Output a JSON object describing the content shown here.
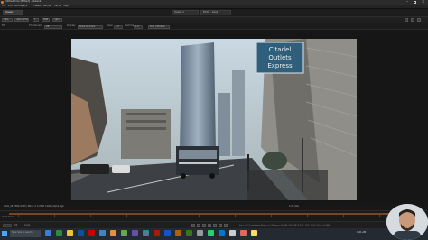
{
  "app": {
    "window_title": "Untitled.hrox [Edited] - Nuke12"
  },
  "menu": [
    "File",
    "Edit",
    "Workspace",
    "Viewer",
    "Render",
    "Cache",
    "Help"
  ],
  "tabs": [
    {
      "label": "Viewer"
    },
    {
      "label": "Viewer 1"
    },
    {
      "label": "Editor - Seq1"
    }
  ],
  "toolbar1": {
    "channels_value": "rgba",
    "alpha_value": "rgba.alpha",
    "a_input": "1",
    "mode_value": "RGB",
    "b_input": "rgba"
  },
  "toolbar2": {
    "fit_label": "Fit",
    "thumbnails_label": "Thumbnails",
    "thumbnails_value": "Off",
    "display_label": "Display",
    "display_value": "Show top track",
    "gain_label": "Gain",
    "gain_value": "1.0",
    "gamma_label": "Gamma",
    "gamma_value": "1.0",
    "view_value": "Sum | Window"
  },
  "frame_signs": {
    "sign_line1": "Citadel",
    "sign_line2": "Outlets",
    "sign_line3": "Express"
  },
  "status": {
    "left_text": "LA02_4K 2560x1440 | Bbox: 0 0 2560 1440 | Alpha: rgb",
    "center_text": "1/43 (4K)"
  },
  "timeline": {
    "in_point": "00:00:00:00",
    "out_point": "00:00:43:00",
    "playhead_percent": 51
  },
  "transport": {
    "frame_field": "1",
    "fps_label": "24",
    "mode_label": "Loop",
    "right_text": "Sync: Off | Localization Mode: On | Memory: 6.1 GB / 63.9 GB (9.5%) | CPU: 120% | Disk: 0.0 MB/s"
  },
  "taskbar": {
    "search_placeholder": "Type here to search",
    "clock": "9:41 AM"
  },
  "colors": {
    "accent_orange": "#c86a2a",
    "ui_bg": "#1b1b1b",
    "taskbar_bg": "#232a31"
  }
}
